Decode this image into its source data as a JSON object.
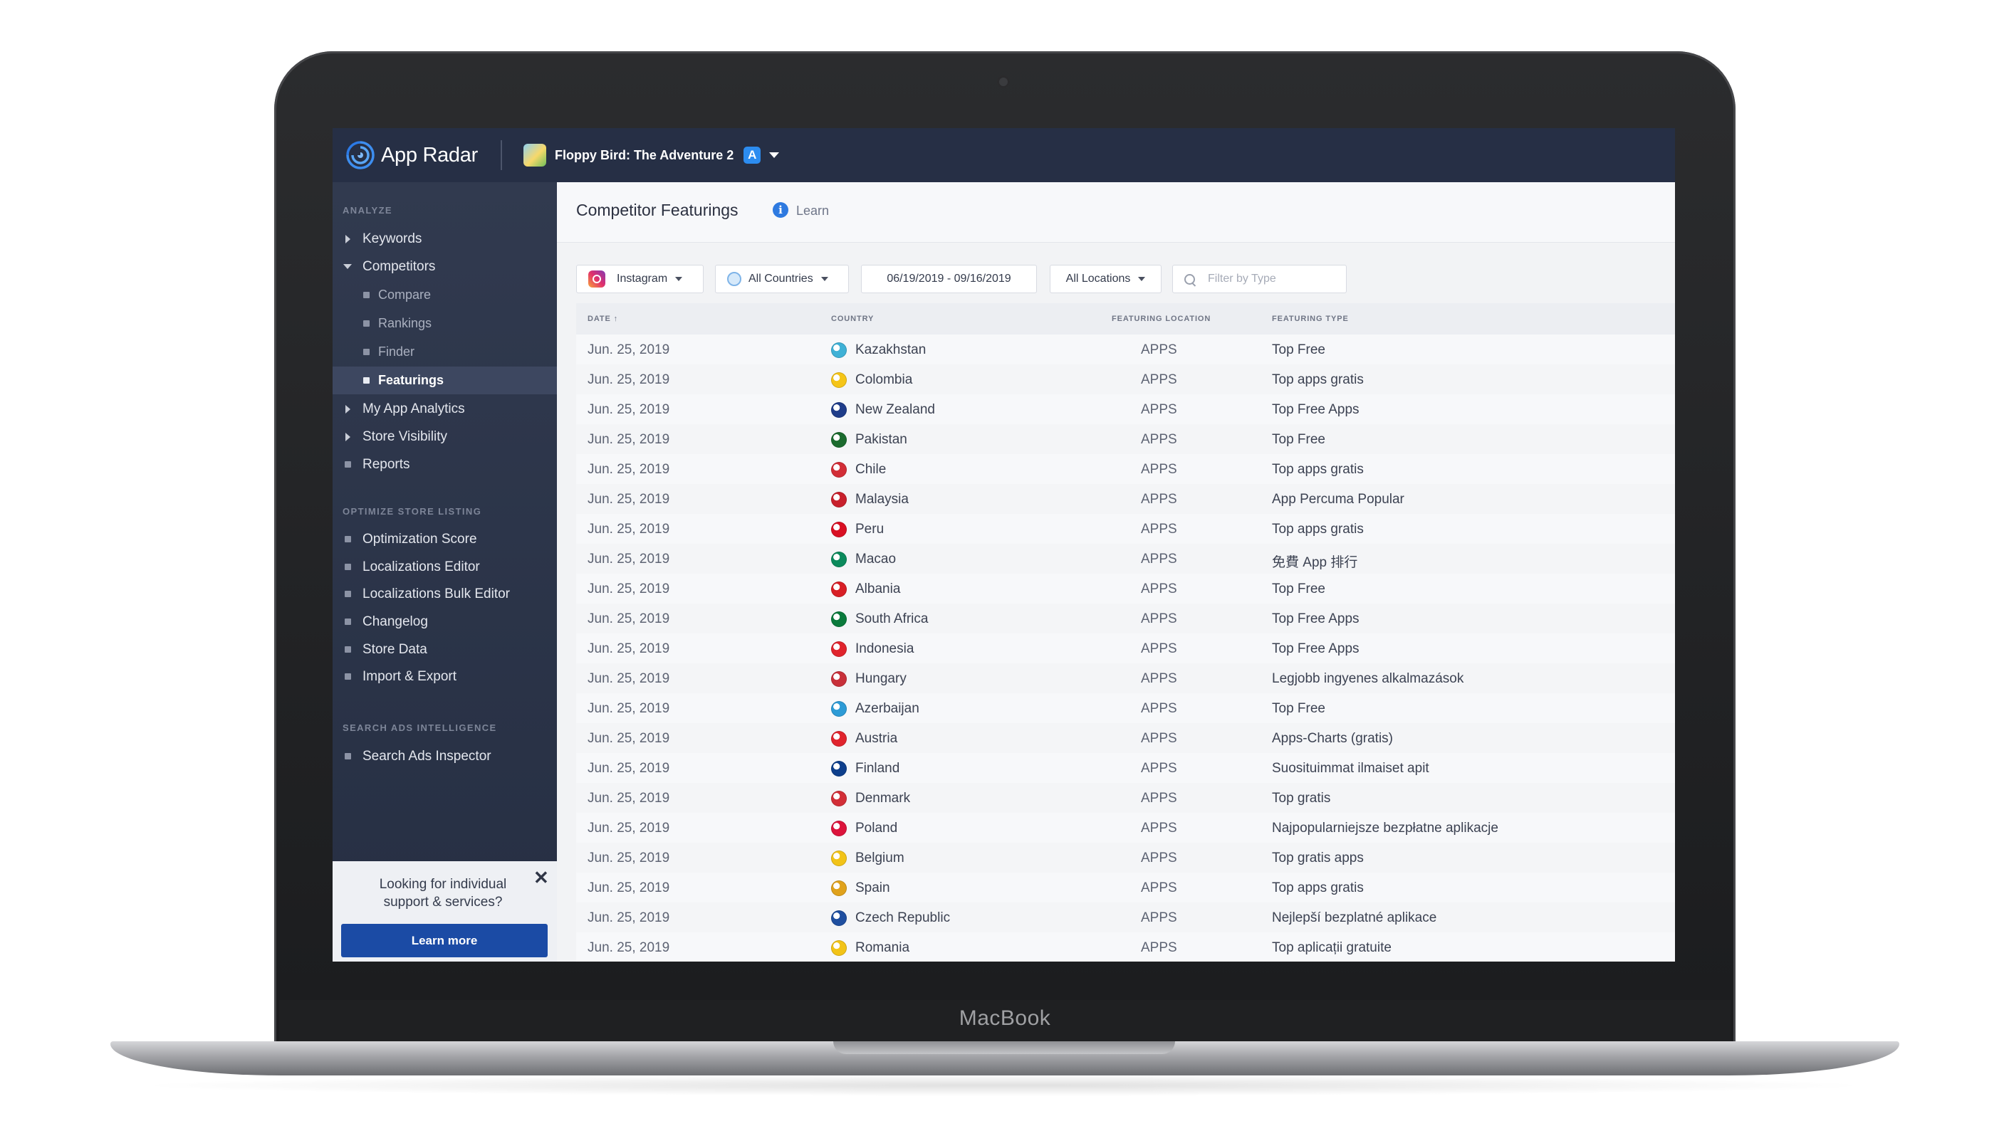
{
  "device": {
    "label": "MacBook"
  },
  "header": {
    "logo_text": "App Radar",
    "app_name": "Floppy Bird: The Adventure 2",
    "store_badge_glyph": "A"
  },
  "sidebar": {
    "analyze_heading": "ANALYZE",
    "analyze_items": [
      {
        "label": "Keywords",
        "icon": "chevron-right-icon"
      },
      {
        "label": "Competitors",
        "icon": "chevron-down-icon"
      },
      {
        "label": "Compare",
        "icon": "bullet-icon"
      },
      {
        "label": "Rankings",
        "icon": "bullet-icon"
      },
      {
        "label": "Finder",
        "icon": "bullet-icon"
      },
      {
        "label": "Featurings",
        "icon": "bullet-icon",
        "active": true
      },
      {
        "label": "My App Analytics",
        "icon": "chevron-right-icon"
      },
      {
        "label": "Store Visibility",
        "icon": "chevron-right-icon"
      },
      {
        "label": "Reports",
        "icon": "bullet-icon"
      }
    ],
    "optimize_heading": "OPTIMIZE STORE LISTING",
    "optimize_items": [
      {
        "label": "Optimization Score"
      },
      {
        "label": "Localizations Editor"
      },
      {
        "label": "Localizations Bulk Editor"
      },
      {
        "label": "Changelog"
      },
      {
        "label": "Store Data"
      },
      {
        "label": "Import & Export"
      }
    ],
    "search_ads_heading": "SEARCH ADS INTELLIGENCE",
    "search_ads_items": [
      {
        "label": "Search Ads Inspector"
      }
    ],
    "promo": {
      "text_line1": "Looking for individual",
      "text_line2": "support & services?",
      "close_glyph": "✕",
      "button_label": "Learn more"
    }
  },
  "main": {
    "title": "Competitor Featurings",
    "info_glyph": "i",
    "learn_label": "Learn",
    "filters": {
      "platform": "Instagram",
      "countries": "All Countries",
      "date_range": "06/19/2019 - 09/16/2019",
      "locations": "All Locations",
      "type_placeholder": "Filter by Type"
    },
    "table": {
      "columns": {
        "date": "DATE ↑",
        "country": "COUNTRY",
        "location": "FEATURING LOCATION",
        "type": "FEATURING TYPE"
      },
      "rows": [
        {
          "date": "Jun. 25, 2019",
          "country": "Kazakhstan",
          "flag": "#3fb1d6",
          "location": "APPS",
          "type": "Top Free"
        },
        {
          "date": "Jun. 25, 2019",
          "country": "Colombia",
          "flag": "#f5c518",
          "location": "APPS",
          "type": "Top apps gratis"
        },
        {
          "date": "Jun. 25, 2019",
          "country": "New Zealand",
          "flag": "#1f3d8a",
          "location": "APPS",
          "type": "Top Free Apps"
        },
        {
          "date": "Jun. 25, 2019",
          "country": "Pakistan",
          "flag": "#1b6b2e",
          "location": "APPS",
          "type": "Top Free"
        },
        {
          "date": "Jun. 25, 2019",
          "country": "Chile",
          "flag": "#d22e37",
          "location": "APPS",
          "type": "Top apps gratis"
        },
        {
          "date": "Jun. 25, 2019",
          "country": "Malaysia",
          "flag": "#c8202c",
          "location": "APPS",
          "type": "App Percuma Popular"
        },
        {
          "date": "Jun. 25, 2019",
          "country": "Peru",
          "flag": "#d91023",
          "location": "APPS",
          "type": "Top apps gratis"
        },
        {
          "date": "Jun. 25, 2019",
          "country": "Macao",
          "flag": "#0b8a5c",
          "location": "APPS",
          "type": "免費 App 排行"
        },
        {
          "date": "Jun. 25, 2019",
          "country": "Albania",
          "flag": "#d81f26",
          "location": "APPS",
          "type": "Top Free"
        },
        {
          "date": "Jun. 25, 2019",
          "country": "South Africa",
          "flag": "#0a7a3c",
          "location": "APPS",
          "type": "Top Free Apps"
        },
        {
          "date": "Jun. 25, 2019",
          "country": "Indonesia",
          "flag": "#e0242d",
          "location": "APPS",
          "type": "Top Free Apps"
        },
        {
          "date": "Jun. 25, 2019",
          "country": "Hungary",
          "flag": "#c8303a",
          "location": "APPS",
          "type": "Legjobb ingyenes alkalmazások"
        },
        {
          "date": "Jun. 25, 2019",
          "country": "Azerbaijan",
          "flag": "#2d9bd6",
          "location": "APPS",
          "type": "Top Free"
        },
        {
          "date": "Jun. 25, 2019",
          "country": "Austria",
          "flag": "#e0242d",
          "location": "APPS",
          "type": "Apps-Charts (gratis)"
        },
        {
          "date": "Jun. 25, 2019",
          "country": "Finland",
          "flag": "#0e3f8c",
          "location": "APPS",
          "type": "Suosituimmat ilmaiset apit"
        },
        {
          "date": "Jun. 25, 2019",
          "country": "Denmark",
          "flag": "#d22e37",
          "location": "APPS",
          "type": "Top gratis"
        },
        {
          "date": "Jun. 25, 2019",
          "country": "Poland",
          "flag": "#dc143c",
          "location": "APPS",
          "type": "Najpopularniejsze bezpłatne aplikacje"
        },
        {
          "date": "Jun. 25, 2019",
          "country": "Belgium",
          "flag": "#f2c318",
          "location": "APPS",
          "type": "Top gratis apps"
        },
        {
          "date": "Jun. 25, 2019",
          "country": "Spain",
          "flag": "#e0a21c",
          "location": "APPS",
          "type": "Top apps gratis"
        },
        {
          "date": "Jun. 25, 2019",
          "country": "Czech Republic",
          "flag": "#1f4fa0",
          "location": "APPS",
          "type": "Nejlepší bezplatné aplikace"
        },
        {
          "date": "Jun. 25, 2019",
          "country": "Romania",
          "flag": "#f2c318",
          "location": "APPS",
          "type": "Top aplicații gratuite"
        }
      ]
    }
  }
}
